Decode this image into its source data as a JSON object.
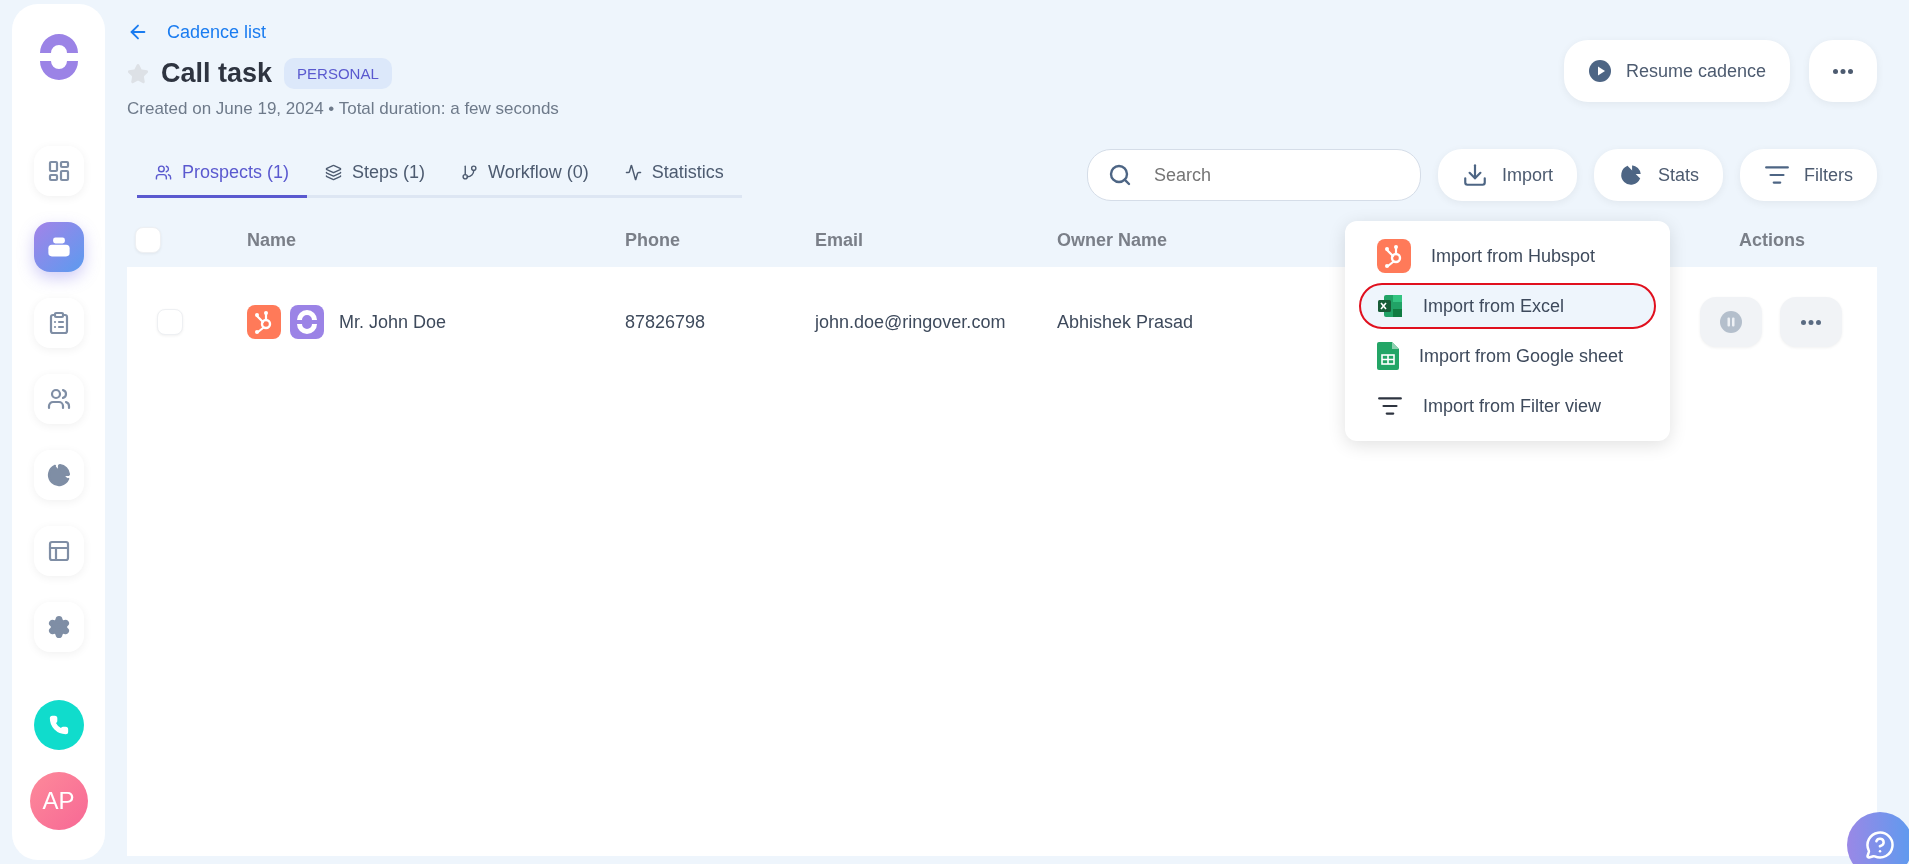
{
  "sidebar": {
    "nav": [
      {
        "selected": false
      },
      {
        "selected": true
      },
      {
        "selected": false
      },
      {
        "selected": false
      },
      {
        "selected": false
      },
      {
        "selected": false
      },
      {
        "selected": false
      }
    ],
    "avatar": "AP"
  },
  "header": {
    "back_link": "Cadence list",
    "title": "Call task",
    "starred": false,
    "badge": "PERSONAL",
    "subtitle": "Created on June 19, 2024 • Total duration: a few seconds"
  },
  "header_actions": {
    "resume": "Resume cadence"
  },
  "tabs": [
    {
      "label": "Prospects (1)",
      "selected": true
    },
    {
      "label": "Steps (1)",
      "selected": false
    },
    {
      "label": "Workflow (0)",
      "selected": false
    },
    {
      "label": "Statistics",
      "selected": false
    }
  ],
  "search": {
    "placeholder": "Search"
  },
  "toolbar": [
    "Import",
    "Stats",
    "Filters"
  ],
  "table": {
    "all_checked": false,
    "columns": [
      "Name",
      "Phone",
      "Email",
      "Owner Name",
      "Actions"
    ],
    "rows": [
      {
        "checked": false,
        "name": "Mr. John Doe",
        "phone": "87826798",
        "email": "john.doe@ringover.com",
        "owner": "Abhishek Prasad"
      }
    ]
  },
  "import_menu": [
    {
      "label": "Import from Hubspot",
      "selected": false
    },
    {
      "label": "Import from Excel",
      "selected": true
    },
    {
      "label": "Import from Google sheet",
      "selected": false
    },
    {
      "label": "Import from Filter view",
      "selected": false
    }
  ]
}
